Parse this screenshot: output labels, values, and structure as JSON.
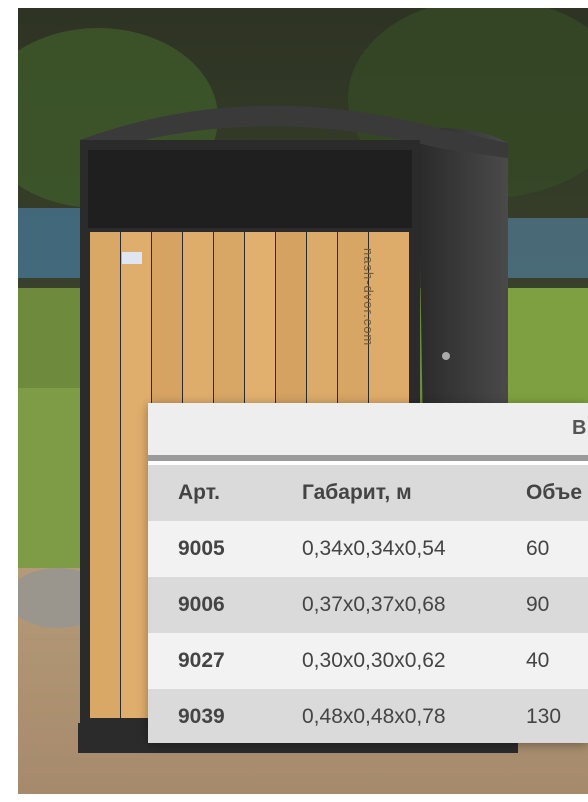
{
  "watermark": "nash-dvor.com",
  "card": {
    "title_fragment": "В",
    "headers": [
      "Арт.",
      "Габарит, м",
      "Объе"
    ],
    "rows": [
      {
        "art": "9005",
        "size": "0,34x0,34x0,54",
        "volume": "60"
      },
      {
        "art": "9006",
        "size": "0,37x0,37x0,68",
        "volume": "90"
      },
      {
        "art": "9027",
        "size": "0,30x0,30x0,62",
        "volume": "40"
      },
      {
        "art": "9039",
        "size": "0,48x0,48x0,78",
        "volume": "130"
      }
    ]
  }
}
